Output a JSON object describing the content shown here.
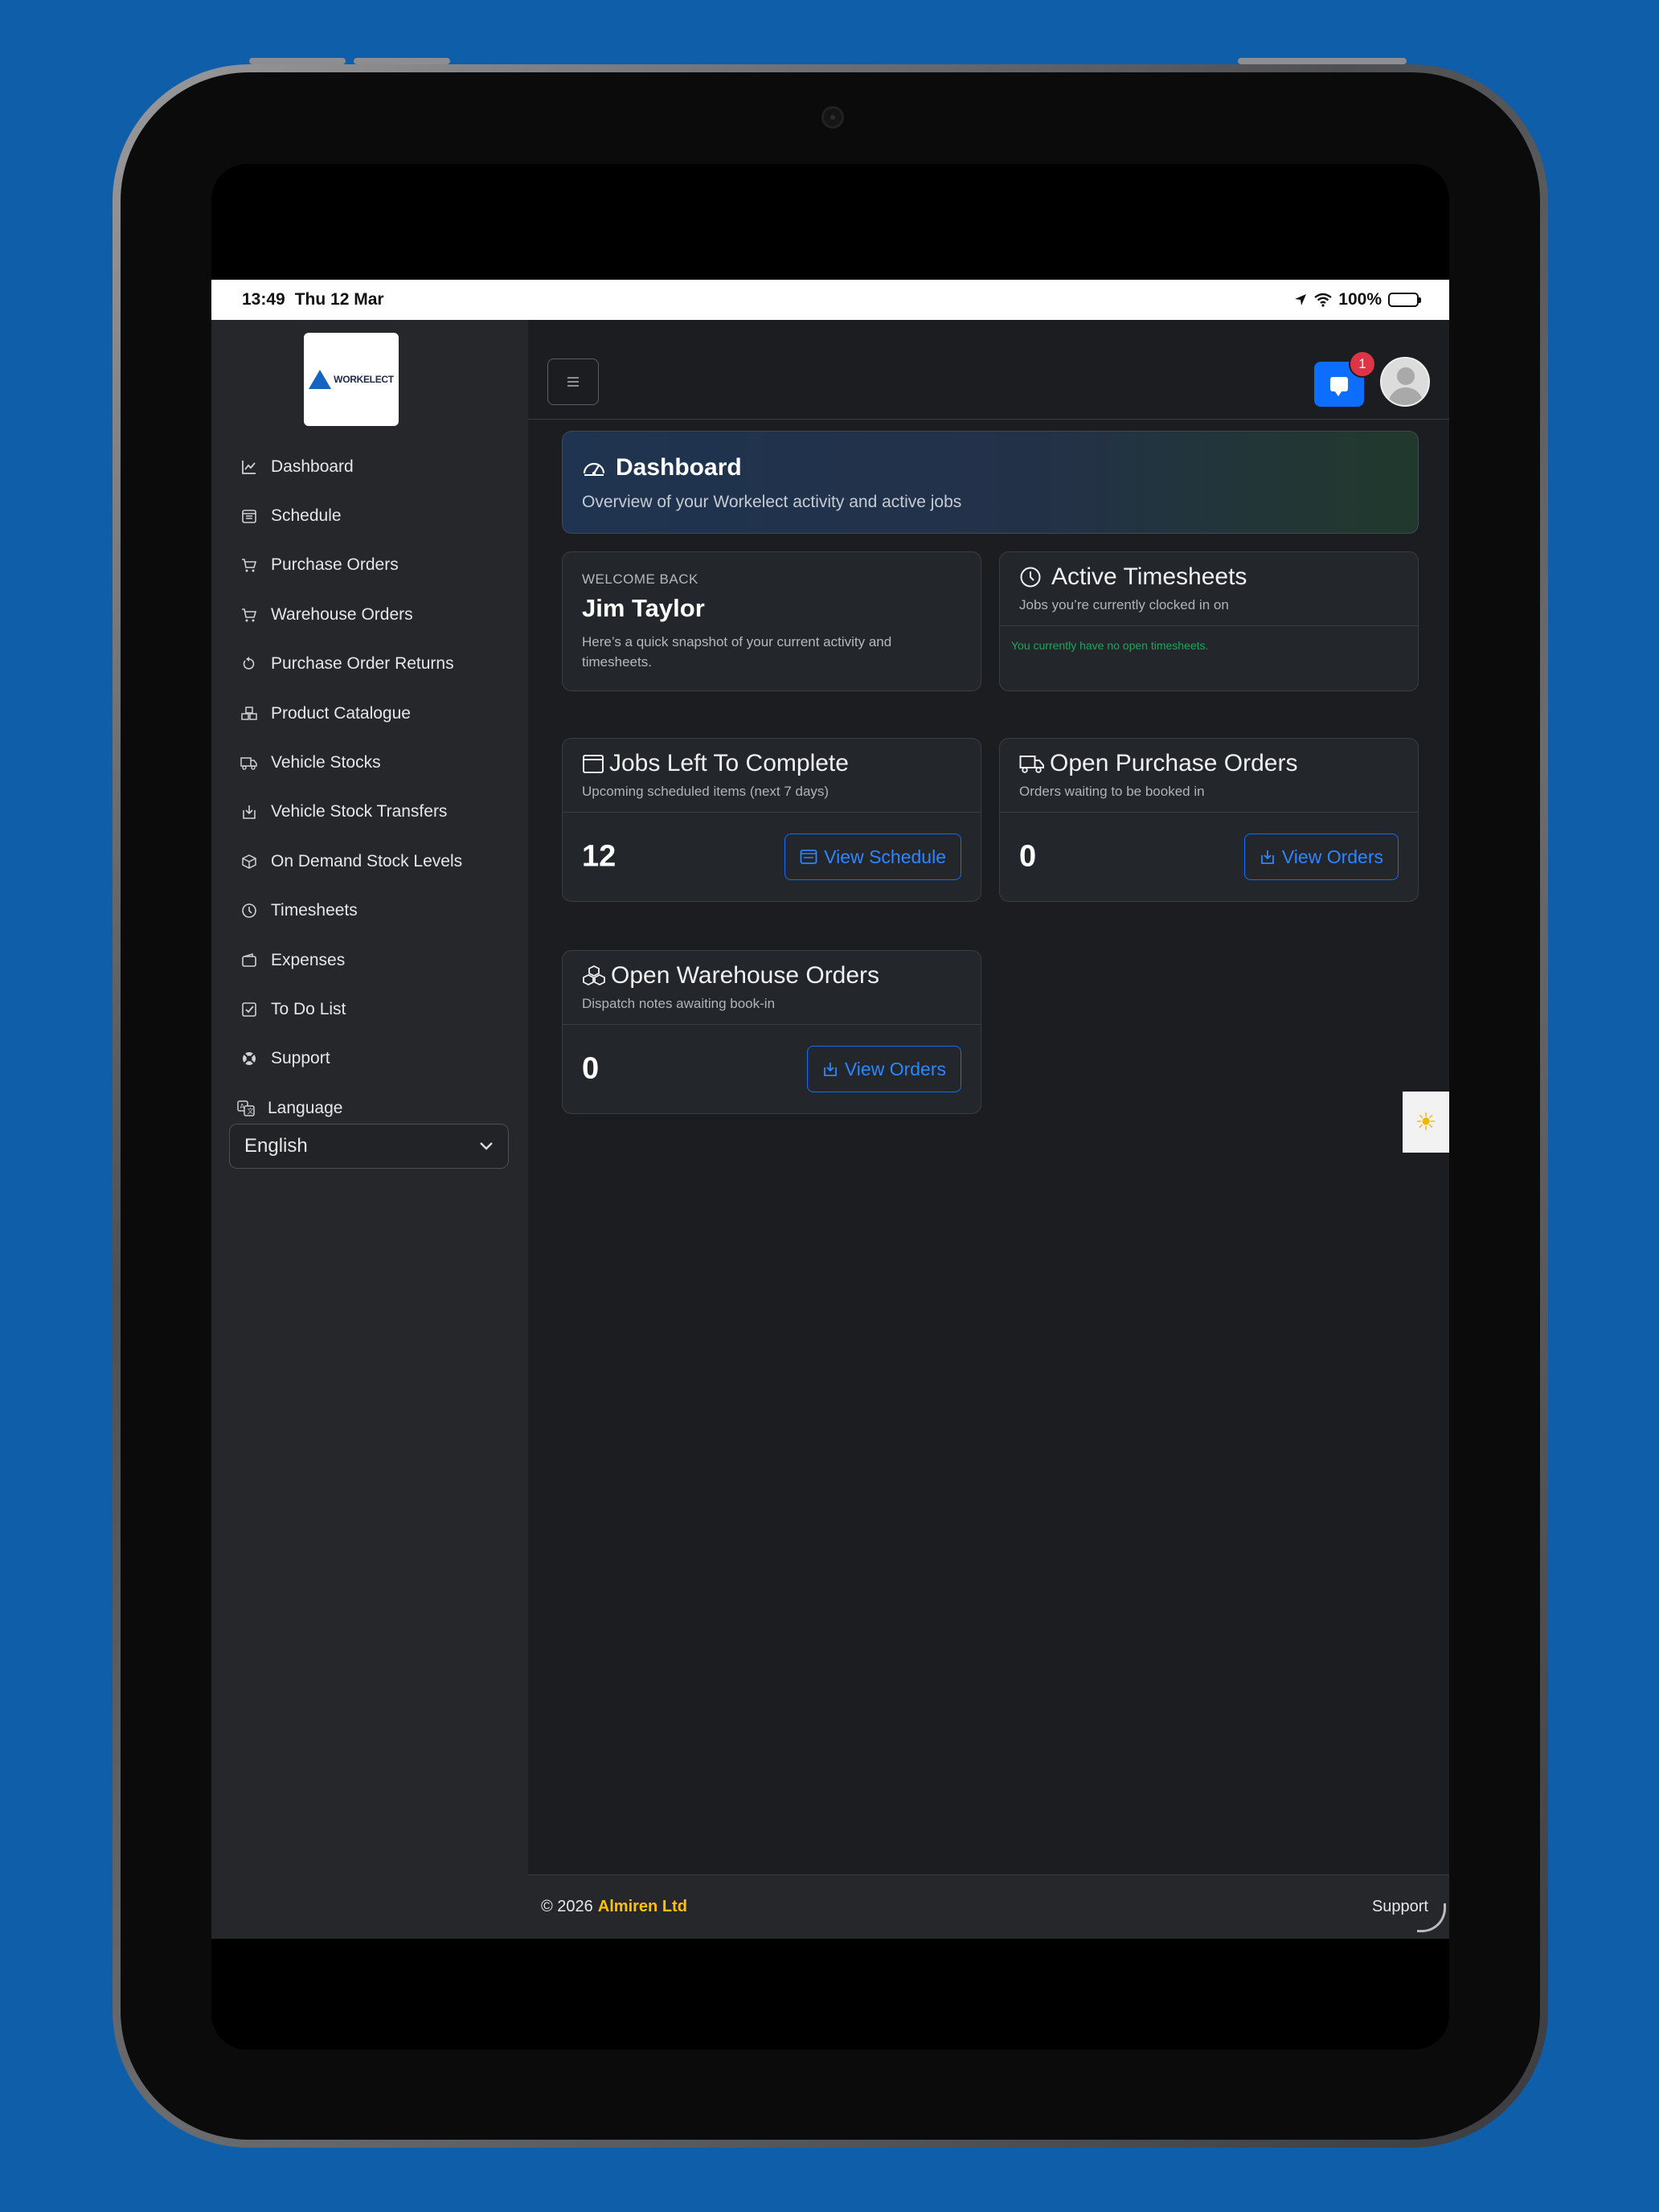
{
  "status_bar": {
    "time": "13:49",
    "date": "Thu 12 Mar",
    "battery": "100%"
  },
  "sidebar": {
    "logo_text": "WORKELECT",
    "items": [
      {
        "label": "Dashboard",
        "icon": "chart-line-icon"
      },
      {
        "label": "Schedule",
        "icon": "calendar-grid-icon"
      },
      {
        "label": "Purchase Orders",
        "icon": "cart-icon"
      },
      {
        "label": "Warehouse Orders",
        "icon": "cart-icon"
      },
      {
        "label": "Purchase Order Returns",
        "icon": "return-arrow-icon"
      },
      {
        "label": "Product Catalogue",
        "icon": "boxes-icon"
      },
      {
        "label": "Vehicle Stocks",
        "icon": "truck-icon"
      },
      {
        "label": "Vehicle Stock Transfers",
        "icon": "box-arrow-in-icon"
      },
      {
        "label": "On Demand Stock Levels",
        "icon": "box-icon"
      },
      {
        "label": "Timesheets",
        "icon": "clock-icon"
      },
      {
        "label": "Expenses",
        "icon": "wallet-icon"
      },
      {
        "label": "To Do List",
        "icon": "check-square-icon"
      },
      {
        "label": "Support",
        "icon": "lifebuoy-icon"
      },
      {
        "label": "Language",
        "icon": "translate-icon"
      }
    ],
    "language_select": {
      "value": "English"
    }
  },
  "topbar": {
    "notification_count": "1"
  },
  "dashboard": {
    "title": "Dashboard",
    "subtitle": "Overview of your Workelect activity and active jobs"
  },
  "welcome": {
    "eyebrow": "WELCOME BACK",
    "name": "Jim Taylor",
    "description": "Here’s a quick snapshot of your current activity and timesheets."
  },
  "timesheets": {
    "title": "Active Timesheets",
    "subtitle": "Jobs you’re currently clocked in on",
    "empty_text": "You currently have no open timesheets."
  },
  "jobs": {
    "title": "Jobs Left To Complete",
    "subtitle": "Upcoming scheduled items (next 7 days)",
    "count": "12",
    "button": "View Schedule"
  },
  "purchase_orders": {
    "title": "Open Purchase Orders",
    "subtitle": "Orders waiting to be booked in",
    "count": "0",
    "button": "View Orders"
  },
  "warehouse_orders": {
    "title": "Open Warehouse Orders",
    "subtitle": "Dispatch notes awaiting book-in",
    "count": "0",
    "button": "View Orders"
  },
  "footer": {
    "copyright": "© 2026",
    "company": "Almiren Ltd",
    "support": "Support"
  },
  "colors": {
    "accent": "#0d6efd",
    "brand_footer": "#ffc107",
    "badge": "#dc3545",
    "success_text": "#1fa55a",
    "background": "#0e5eaa"
  }
}
